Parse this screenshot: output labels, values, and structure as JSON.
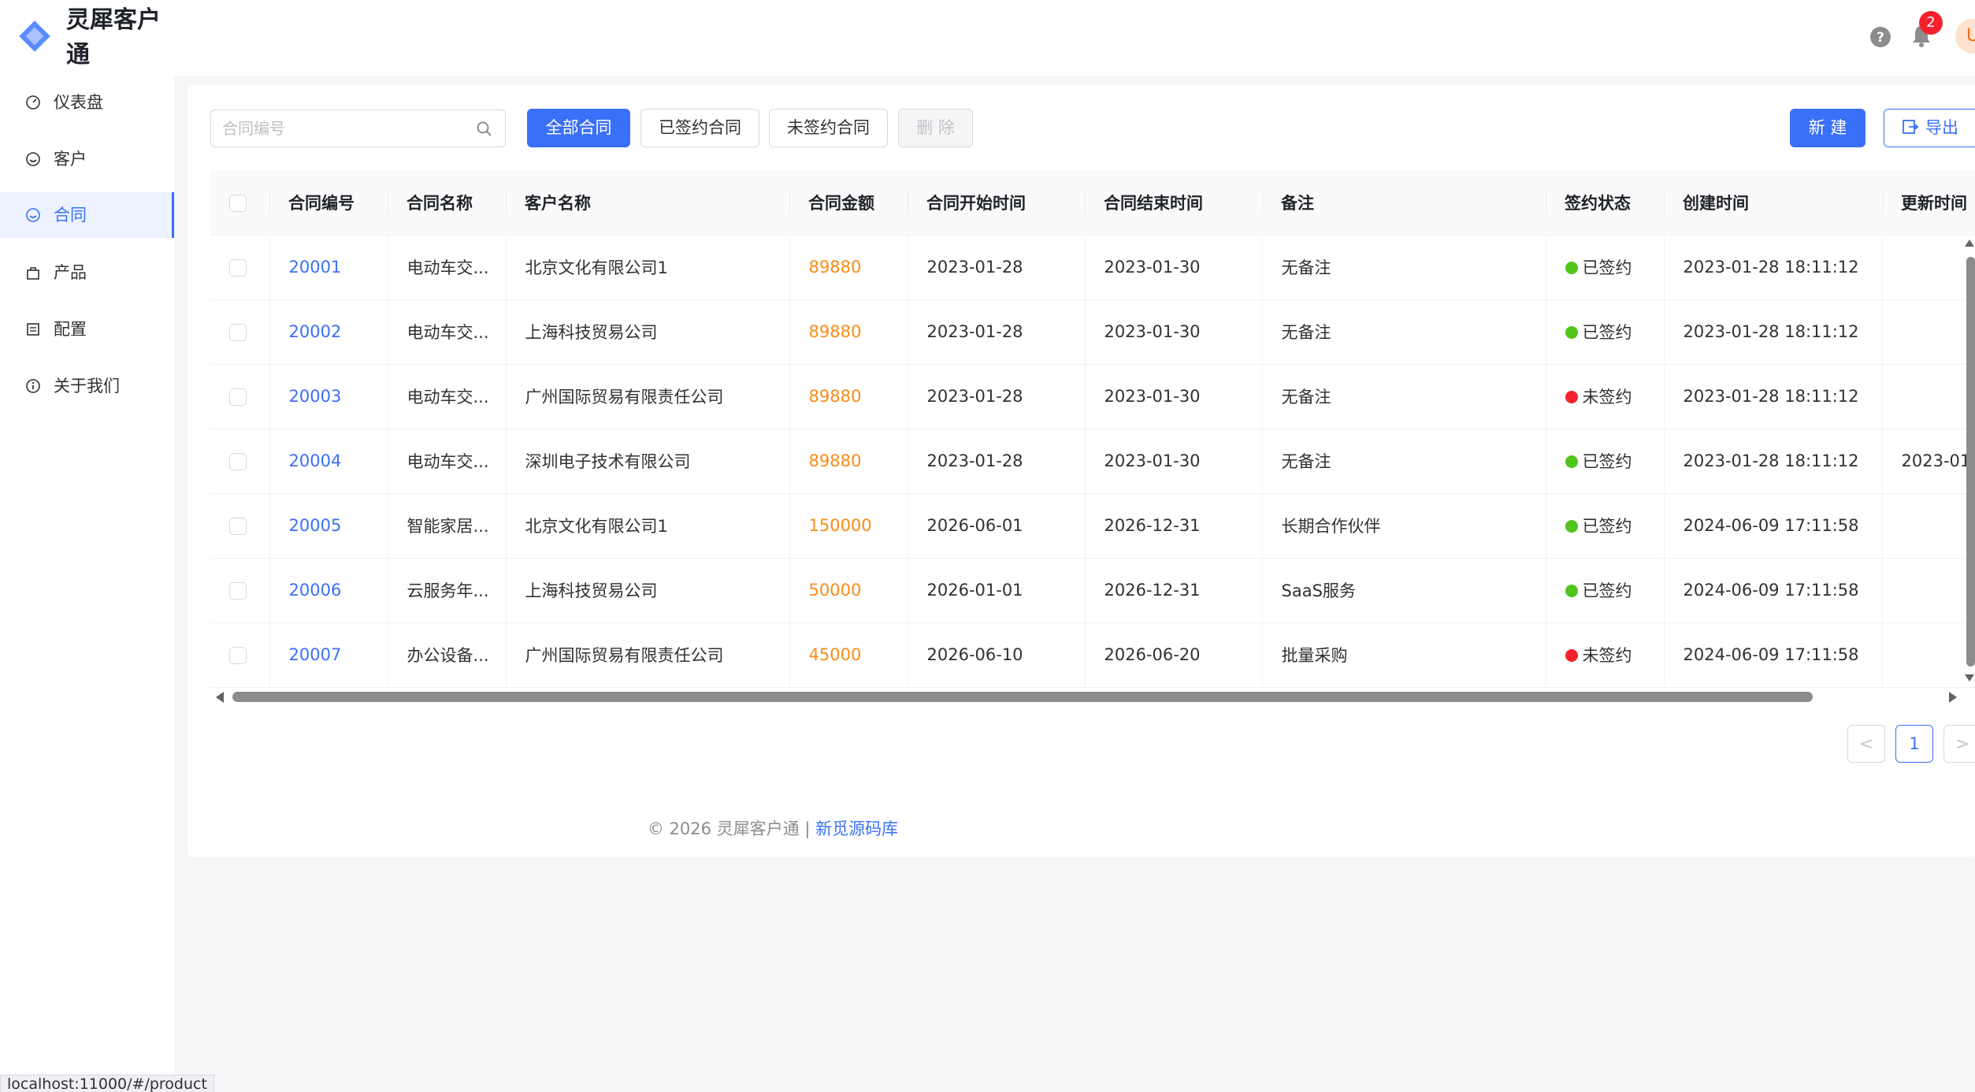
{
  "app": {
    "title": "灵犀客户通"
  },
  "sidebar": {
    "items": [
      {
        "label": "仪表盘",
        "icon": "dashboard-icon"
      },
      {
        "label": "客户",
        "icon": "smile-icon"
      },
      {
        "label": "合同",
        "icon": "smile-icon",
        "active": true
      },
      {
        "label": "产品",
        "icon": "shopping-bag-icon"
      },
      {
        "label": "配置",
        "icon": "list-icon"
      },
      {
        "label": "关于我们",
        "icon": "info-icon"
      }
    ]
  },
  "header": {
    "notifications": "2",
    "avatar_initial": "U"
  },
  "toolbar": {
    "search_placeholder": "合同编号",
    "filters": [
      "全部合同",
      "已签约合同",
      "未签约合同"
    ],
    "delete_label": "删 除",
    "new_label": "新 建",
    "export_label": "导出"
  },
  "table": {
    "columns": [
      "合同编号",
      "合同名称",
      "客户名称",
      "合同金额",
      "合同开始时间",
      "合同结束时间",
      "备注",
      "签约状态",
      "创建时间",
      "更新时间"
    ],
    "rows": [
      {
        "id": "20001",
        "name": "电动车交...",
        "customer": "北京文化有限公司1",
        "amount": "89880",
        "start": "2023-01-28",
        "end": "2023-01-30",
        "note": "无备注",
        "status": "已签约",
        "signed": true,
        "created": "2023-01-28 18:11:12",
        "updated": ""
      },
      {
        "id": "20002",
        "name": "电动车交...",
        "customer": "上海科技贸易公司",
        "amount": "89880",
        "start": "2023-01-28",
        "end": "2023-01-30",
        "note": "无备注",
        "status": "已签约",
        "signed": true,
        "created": "2023-01-28 18:11:12",
        "updated": ""
      },
      {
        "id": "20003",
        "name": "电动车交...",
        "customer": "广州国际贸易有限责任公司",
        "amount": "89880",
        "start": "2023-01-28",
        "end": "2023-01-30",
        "note": "无备注",
        "status": "未签约",
        "signed": false,
        "created": "2023-01-28 18:11:12",
        "updated": ""
      },
      {
        "id": "20004",
        "name": "电动车交...",
        "customer": "深圳电子技术有限公司",
        "amount": "89880",
        "start": "2023-01-28",
        "end": "2023-01-30",
        "note": "无备注",
        "status": "已签约",
        "signed": true,
        "created": "2023-01-28 18:11:12",
        "updated": "2023-01"
      },
      {
        "id": "20005",
        "name": "智能家居...",
        "customer": "北京文化有限公司1",
        "amount": "150000",
        "start": "2026-06-01",
        "end": "2026-12-31",
        "note": "长期合作伙伴",
        "status": "已签约",
        "signed": true,
        "created": "2024-06-09 17:11:58",
        "updated": ""
      },
      {
        "id": "20006",
        "name": "云服务年...",
        "customer": "上海科技贸易公司",
        "amount": "50000",
        "start": "2026-01-01",
        "end": "2026-12-31",
        "note": "SaaS服务",
        "status": "已签约",
        "signed": true,
        "created": "2024-06-09 17:11:58",
        "updated": ""
      },
      {
        "id": "20007",
        "name": "办公设备...",
        "customer": "广州国际贸易有限责任公司",
        "amount": "45000",
        "start": "2026-06-10",
        "end": "2026-06-20",
        "note": "批量采购",
        "status": "未签约",
        "signed": false,
        "created": "2024-06-09 17:11:58",
        "updated": ""
      }
    ]
  },
  "pagination": {
    "current": "1",
    "prev": "<",
    "next": ">"
  },
  "footer": {
    "text": "© 2026 灵犀客户通 | ",
    "link": "新觅源码库"
  },
  "statusbar": {
    "url": "localhost:11000/#/product"
  },
  "colors": {
    "primary": "#3a6ff7",
    "amount": "#fa8c16",
    "signed": "#52c41a",
    "unsigned": "#f5222d"
  }
}
